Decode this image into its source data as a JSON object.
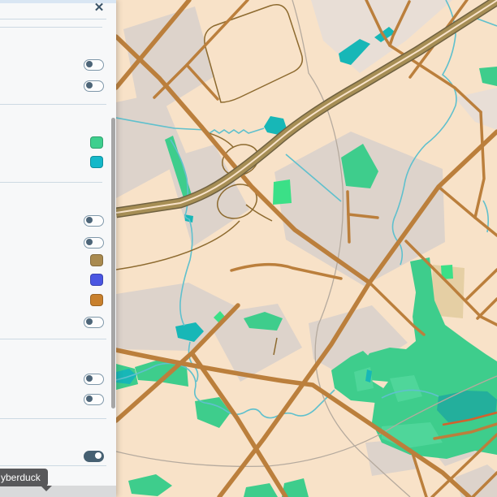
{
  "sidebar": {
    "close_icon": "✕",
    "toggles": [
      {
        "state": "off"
      },
      {
        "state": "off"
      },
      {
        "state": "off"
      },
      {
        "state": "off"
      },
      {
        "state": "off"
      },
      {
        "state": "off"
      },
      {
        "state": "off"
      },
      {
        "state": "on"
      }
    ],
    "swatches": [
      {
        "name": "green",
        "color": "#3ecf8e"
      },
      {
        "name": "teal",
        "color": "#14b8c9"
      },
      {
        "name": "tan",
        "color": "#a98a4f"
      },
      {
        "name": "indigo",
        "color": "#4a56e2"
      },
      {
        "name": "orange",
        "color": "#c8802d"
      }
    ],
    "tooltip": {
      "text": "yberduck"
    }
  },
  "map": {
    "palette": {
      "background": "#f8e2c8",
      "block": "#ddd3cb",
      "block_light": "#e8ded6",
      "khaki": "#e5cfa4",
      "park": "#3ecd8c",
      "park_bright": "#3be087",
      "park_light": "#4fd69a",
      "water": "#17b7b7",
      "lake": "#23af9c",
      "stream": "#5fc0cd",
      "railway": "#b5aa9e",
      "ramp": "#8d6a2f",
      "road": "#bb7f3c",
      "motorway_fill": "#a68e55",
      "motorway_casing": "#6f6140",
      "red_road": "#d2622d"
    }
  }
}
